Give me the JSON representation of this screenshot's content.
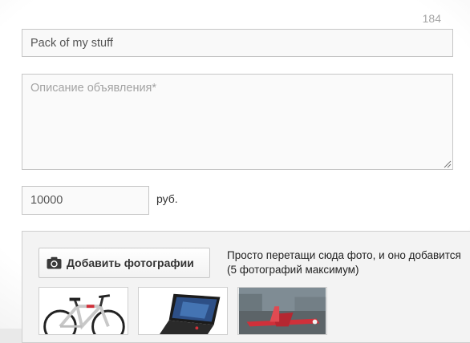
{
  "form": {
    "title_counter": "184",
    "title_value": "Pack of my stuff",
    "description_placeholder": "Описание объявления*",
    "price_value": "10000",
    "currency_label": "руб."
  },
  "photos": {
    "add_button_label": "Добавить фотографии",
    "hint_line1": "Просто перетащи сюда фото, и оно добавится",
    "hint_line2": "(5 фотографий максимум)",
    "thumbnails": [
      {
        "name": "bicycle-photo"
      },
      {
        "name": "laptop-photo"
      },
      {
        "name": "airplane-photo"
      }
    ]
  },
  "colors": {
    "accent_red": "#d0303a",
    "border": "#c6c6c6"
  }
}
